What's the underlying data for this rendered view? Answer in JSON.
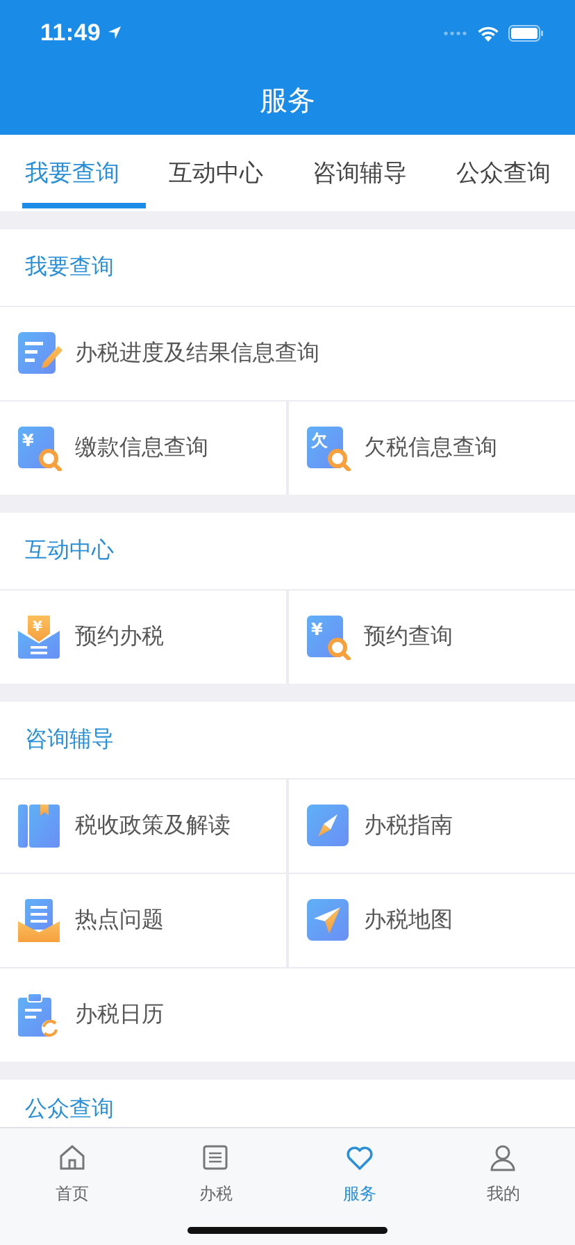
{
  "status_bar": {
    "time": "11:49"
  },
  "nav_bar": {
    "title": "服务"
  },
  "tabs": [
    {
      "label": "我要查询",
      "selected": true
    },
    {
      "label": "互动中心",
      "selected": false
    },
    {
      "label": "咨询辅导",
      "selected": false
    },
    {
      "label": "公众查询",
      "selected": false
    }
  ],
  "sections": [
    {
      "title": "我要查询",
      "rows": [
        [
          {
            "label": "办税进度及结果信息查询",
            "kind": "progress"
          }
        ],
        [
          {
            "label": "缴款信息查询",
            "kind": "glyph-search",
            "glyph": "¥"
          },
          {
            "label": "欠税信息查询",
            "kind": "glyph-search",
            "glyph": "欠"
          }
        ]
      ]
    },
    {
      "title": "互动中心",
      "rows": [
        [
          {
            "label": "预约办税",
            "kind": "envelope",
            "glyph": "¥"
          },
          {
            "label": "预约查询",
            "kind": "glyph-search",
            "glyph": "¥"
          }
        ]
      ]
    },
    {
      "title": "咨询辅导",
      "rows": [
        [
          {
            "label": "税收政策及解读",
            "kind": "book"
          },
          {
            "label": "办税指南",
            "kind": "compass"
          }
        ],
        [
          {
            "label": "热点问题",
            "kind": "tray"
          },
          {
            "label": "办税地图",
            "kind": "plane"
          }
        ],
        [
          {
            "label": "办税日历",
            "kind": "calendar"
          }
        ]
      ]
    },
    {
      "title": "公众查询"
    }
  ],
  "bottom_tabs": [
    {
      "label": "首页",
      "kind": "home",
      "selected": false
    },
    {
      "label": "办税",
      "kind": "list",
      "selected": false
    },
    {
      "label": "服务",
      "kind": "heart",
      "selected": true
    },
    {
      "label": "我的",
      "kind": "person",
      "selected": false
    }
  ]
}
